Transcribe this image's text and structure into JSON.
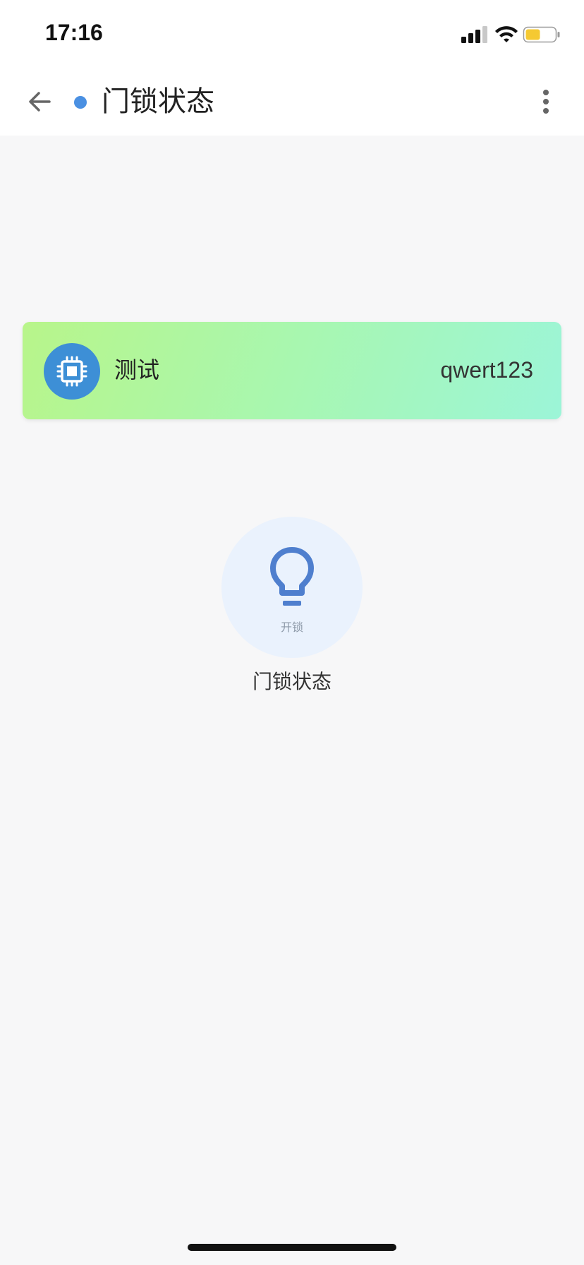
{
  "status_bar": {
    "time": "17:16"
  },
  "header": {
    "title": "门锁状态"
  },
  "device": {
    "name": "测试",
    "id": "qwert123"
  },
  "lock": {
    "status": "开锁",
    "label": "门锁状态"
  },
  "colors": {
    "accent": "#4a90e2",
    "avatar": "#3d8fd6",
    "bulb": "#4f7fce",
    "card_gradient_start": "#b8f58a",
    "card_gradient_end": "#9cf5d8",
    "battery": "#f5c932"
  },
  "icons": {
    "back": "arrow-left-icon",
    "more": "more-vertical-icon",
    "device": "chip-icon",
    "lock": "lightbulb-icon"
  }
}
